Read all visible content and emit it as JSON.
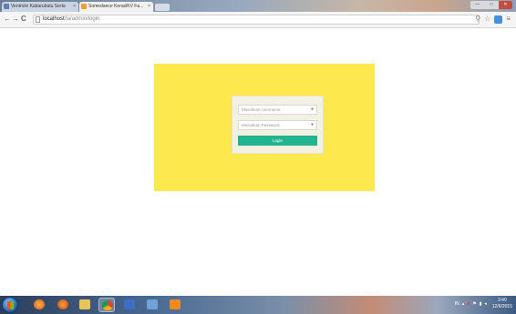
{
  "browser": {
    "tabs": [
      {
        "label": "Ventricle Kabarubutu Serta",
        "active": false
      },
      {
        "label": "Somedance KeraslKV Fa...",
        "active": true
      }
    ],
    "window_controls": {
      "minimize": "—",
      "maximize": "□",
      "close": "✕"
    },
    "nav": {
      "back": "←",
      "forward": "→",
      "reload": "C"
    },
    "address": {
      "host": "localhost",
      "path": "/la/admin/login"
    },
    "toolbar_icons": {
      "zoom": "⚲",
      "star": "☆",
      "menu": "≡"
    }
  },
  "login": {
    "username_placeholder": "Masukkan Username",
    "password_placeholder": "Masukkan Password",
    "username_icon": "●",
    "password_icon": "●",
    "button_label": "Login",
    "colors": {
      "panel": "#fde84d",
      "button": "#22b48f"
    }
  },
  "taskbar": {
    "tray_language": "IN",
    "clock_time": "3:40",
    "clock_date": "12/6/2015"
  }
}
